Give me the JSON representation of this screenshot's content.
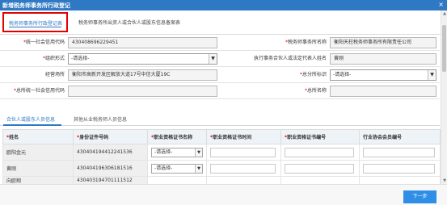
{
  "window": {
    "title": "新增税务师事务所行政登记",
    "close_glyph": "×"
  },
  "top_tabs": [
    {
      "label": "税务师事务所行政登记表"
    },
    {
      "label": "税务师事务所出资人或合伙人或股东信息备案表"
    }
  ],
  "form": {
    "credit_code": {
      "label": "统一社会信用代码",
      "value": "430408696229451"
    },
    "firm_name": {
      "label": "税务师事务所名称",
      "value": "衡阳天柱税务师事务所有限责任公司"
    },
    "org_form": {
      "label": "组织形式",
      "value": "-请选择-"
    },
    "rep_name": {
      "label": "执行事务合伙人或法定代表人姓名",
      "value": "黄刚"
    },
    "address": {
      "label": "经营场所",
      "value": "衡阳市高新开发区解放大道17号中信大厦19C"
    },
    "branch_flag": {
      "label": "总分所标识",
      "value": "-请选择-"
    },
    "hq_credit_code": {
      "label": "总所统一社会信用代码",
      "value": ""
    },
    "hq_name": {
      "label": "总所名称",
      "value": ""
    }
  },
  "sub_tabs": [
    {
      "label": "合伙人或股东人员信息"
    },
    {
      "label": "其他从业税务师人员信息"
    }
  ],
  "table": {
    "headers": [
      "姓名",
      "身份证件号码",
      "职业资格证书名称",
      "职业资格证书时间",
      "职业资格证书编号",
      "行业协会会员编号"
    ],
    "required": [
      true,
      true,
      true,
      true,
      true,
      false
    ],
    "rows": [
      {
        "name": "欧阳金元",
        "id": "430404194412241536",
        "cert": "-请选择-"
      },
      {
        "name": "黄刚",
        "id": "430404196306181516",
        "cert": "-请选择-"
      },
      {
        "name": "向欧翔",
        "id": "430403194701111512",
        "cert": ""
      }
    ]
  },
  "buttons": {
    "next": "下一步"
  }
}
